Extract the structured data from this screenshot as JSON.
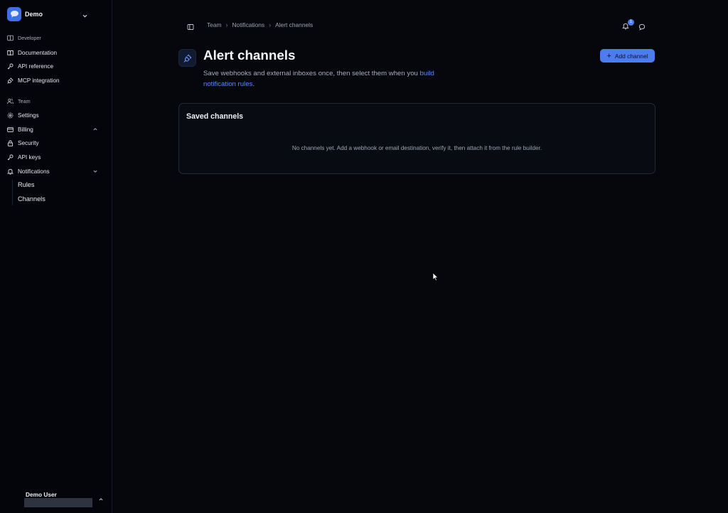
{
  "workspace": {
    "name": "Demo"
  },
  "sidebar": {
    "developer_label": "Developer",
    "developer_items": [
      {
        "label": "Documentation",
        "icon": "book-icon"
      },
      {
        "label": "API reference",
        "icon": "key-icon"
      },
      {
        "label": "MCP integration",
        "icon": "plug-icon"
      }
    ],
    "team_label": "Team",
    "team_items": [
      {
        "label": "Settings",
        "icon": "gear-icon"
      },
      {
        "label": "Billing",
        "icon": "credit-card-icon",
        "expanded": true
      },
      {
        "label": "Security",
        "icon": "lock-icon"
      },
      {
        "label": "API keys",
        "icon": "key-icon"
      },
      {
        "label": "Notifications",
        "icon": "bell-icon",
        "expanded": true
      }
    ],
    "notifications_sub": [
      {
        "label": "Rules"
      },
      {
        "label": "Channels"
      }
    ],
    "user": {
      "name": "Demo User"
    }
  },
  "breadcrumb": [
    "Team",
    "Notifications",
    "Alert channels"
  ],
  "header": {
    "notification_count": "1",
    "title": "Alert channels",
    "description_prefix": "Save webhooks and external inboxes once, then select them when you ",
    "description_link": "build notification rules",
    "description_suffix": ".",
    "add_button_label": "Add channel"
  },
  "saved_channels": {
    "title": "Saved channels",
    "empty_message": "No channels yet. Add a webhook or email destination, verify it, then attach it from the rule builder."
  },
  "colors": {
    "accent": "#4d7bf0",
    "link": "#5e8cf6",
    "background": "#05070d",
    "sidebar": "#03050a"
  }
}
